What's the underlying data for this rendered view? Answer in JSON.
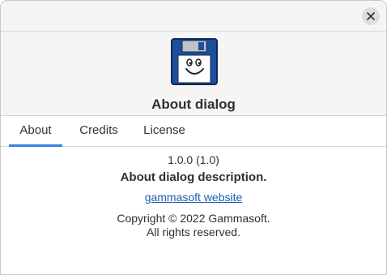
{
  "window": {
    "close_icon": "close-icon"
  },
  "header": {
    "logo_icon": "floppy-disk-smiley-icon",
    "app_name": "About dialog"
  },
  "tabs": [
    {
      "label": "About",
      "active": true
    },
    {
      "label": "Credits",
      "active": false
    },
    {
      "label": "License",
      "active": false
    }
  ],
  "about": {
    "version": "1.0.0 (1.0)",
    "description": "About dialog description.",
    "website_label": "gammasoft website",
    "copyright_line1": "Copyright © 2022 Gammasoft.",
    "copyright_line2": "All rights reserved."
  },
  "colors": {
    "accent": "#3584e4",
    "link": "#1a5fb4",
    "logo_blue": "#1f4f9a"
  }
}
